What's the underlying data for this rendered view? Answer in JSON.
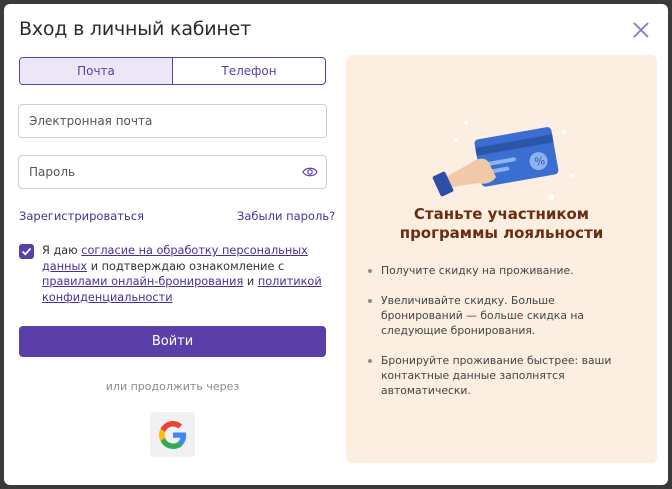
{
  "dialog": {
    "title": "Вход в личный кабинет"
  },
  "tabs": [
    {
      "label": "Почта",
      "active": true
    },
    {
      "label": "Телефон",
      "active": false
    }
  ],
  "form": {
    "email_placeholder": "Электронная почта",
    "password_placeholder": "Пароль",
    "register_link": "Зарегистрироваться",
    "forgot_link": "Забыли пароль?",
    "consent": {
      "checked": true,
      "part1": "Я даю ",
      "link1": "согласие на обработку персональных данных",
      "part2": " и подтверждаю ознакомление с ",
      "link2": "правилами онлайн-бронирования",
      "part3": " и ",
      "link3": "политикой конфиденциальности"
    },
    "submit_label": "Войти",
    "or_text": "или продолжить через"
  },
  "promo": {
    "title": "Станьте участником программы лояльности",
    "items": [
      "Получите скидку на проживание.",
      "Увеличивайте скидку. Больше бронирований — больше скидка на следующие бронирования.",
      "Бронируйте проживание быстрее: ваши контактные данные заполнятся автоматически."
    ]
  },
  "colors": {
    "accent": "#5b3fa8",
    "promo_bg": "#fdeee2",
    "promo_title": "#6b2c10"
  }
}
